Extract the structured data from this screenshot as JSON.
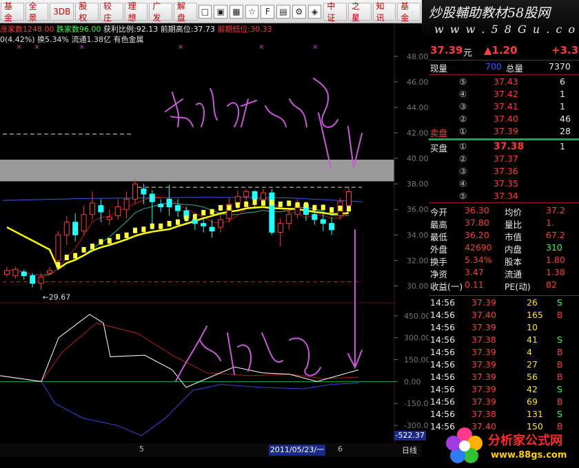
{
  "toolbar": {
    "buttons": [
      "基金",
      "全景",
      "3DB",
      "股权",
      "较庄",
      "理想",
      "广发",
      "解盘",
      "中证",
      "之星",
      "知讯",
      "基金"
    ]
  },
  "brand": {
    "title": "炒股輔助教材58股网",
    "url": "w w w . 5 8 G u . c o m"
  },
  "infobar": {
    "up_label": "涨家数",
    "up_value": "1248.00",
    "down_label": "跌家数",
    "down_value": "96.00",
    "profit_label": "获利比例:",
    "profit_value": "92.13",
    "high_label": "前期高位:",
    "high_value": "37.73",
    "low_label": "前期低位:",
    "low_value": "30.33"
  },
  "subbar": {
    "text": "0(4.42%) 换5.34% 流通1.38亿 有色金属"
  },
  "chart_data": {
    "type": "candlestick",
    "price_axis": {
      "ticks": [
        30,
        32,
        34,
        36,
        38,
        40,
        42,
        44,
        46,
        48
      ],
      "range": [
        29,
        49.5
      ]
    },
    "indicator_axis": {
      "ticks": [
        450,
        300,
        150,
        0,
        -150,
        -300
      ],
      "range": [
        -375,
        520
      ]
    },
    "candles": [
      {
        "o": 30.9,
        "c": 31.2,
        "h": 31.5,
        "l": 30.7
      },
      {
        "o": 30.8,
        "c": 31.3,
        "h": 31.5,
        "l": 30.6
      },
      {
        "o": 31.1,
        "c": 30.8,
        "h": 31.3,
        "l": 30.5
      },
      {
        "o": 30.8,
        "c": 30.2,
        "h": 31.0,
        "l": 29.9
      },
      {
        "o": 30.2,
        "c": 30.7,
        "h": 31.0,
        "l": 29.67
      },
      {
        "o": 31.0,
        "c": 31.2,
        "h": 31.5,
        "l": 30.9
      },
      {
        "o": 32.0,
        "c": 34.0,
        "h": 34.3,
        "l": 31.8
      },
      {
        "o": 34.0,
        "c": 35.0,
        "h": 35.5,
        "l": 33.2
      },
      {
        "o": 35.0,
        "c": 34.0,
        "h": 35.7,
        "l": 33.5
      },
      {
        "o": 34.3,
        "c": 35.6,
        "h": 36.3,
        "l": 34.0
      },
      {
        "o": 35.6,
        "c": 36.5,
        "h": 37.4,
        "l": 35.2
      },
      {
        "o": 36.3,
        "c": 35.8,
        "h": 36.8,
        "l": 35.0
      },
      {
        "o": 35.2,
        "c": 35.4,
        "h": 36.0,
        "l": 34.8
      },
      {
        "o": 35.5,
        "c": 36.2,
        "h": 36.8,
        "l": 35.2
      },
      {
        "o": 36.0,
        "c": 36.8,
        "h": 37.4,
        "l": 35.3
      },
      {
        "o": 36.8,
        "c": 38.0,
        "h": 38.4,
        "l": 36.4
      },
      {
        "o": 37.6,
        "c": 37.2,
        "h": 38.0,
        "l": 36.4
      },
      {
        "o": 37.2,
        "c": 36.6,
        "h": 37.5,
        "l": 34.4
      },
      {
        "o": 36.4,
        "c": 36.2,
        "h": 36.8,
        "l": 35.8
      },
      {
        "o": 36.8,
        "c": 36.2,
        "h": 37.9,
        "l": 35.5
      },
      {
        "o": 36.3,
        "c": 35.9,
        "h": 36.8,
        "l": 35.4
      },
      {
        "o": 35.9,
        "c": 35.3,
        "h": 36.2,
        "l": 35.0
      },
      {
        "o": 35.2,
        "c": 34.9,
        "h": 35.7,
        "l": 34.4
      },
      {
        "o": 34.9,
        "c": 34.7,
        "h": 35.3,
        "l": 34.2
      },
      {
        "o": 34.6,
        "c": 34.3,
        "h": 35.2,
        "l": 33.8
      },
      {
        "o": 34.6,
        "c": 35.2,
        "h": 35.6,
        "l": 34.2
      },
      {
        "o": 35.3,
        "c": 36.4,
        "h": 36.9,
        "l": 35.0
      },
      {
        "o": 36.4,
        "c": 37.0,
        "h": 37.5,
        "l": 36.0
      },
      {
        "o": 37.0,
        "c": 37.4,
        "h": 37.6,
        "l": 36.6
      },
      {
        "o": 37.4,
        "c": 36.8,
        "h": 37.5,
        "l": 36.2
      },
      {
        "o": 36.8,
        "c": 37.3,
        "h": 37.6,
        "l": 36.3
      },
      {
        "o": 37.3,
        "c": 34.2,
        "h": 37.6,
        "l": 34.0
      },
      {
        "o": 34.2,
        "c": 34.9,
        "h": 35.3,
        "l": 33.1
      },
      {
        "o": 34.9,
        "c": 35.6,
        "h": 36.0,
        "l": 34.4
      },
      {
        "o": 35.6,
        "c": 36.4,
        "h": 36.8,
        "l": 35.3
      },
      {
        "o": 36.4,
        "c": 35.6,
        "h": 36.6,
        "l": 35.1
      },
      {
        "o": 35.6,
        "c": 35.2,
        "h": 36.0,
        "l": 34.8
      },
      {
        "o": 35.2,
        "c": 34.9,
        "h": 35.8,
        "l": 34.3
      },
      {
        "o": 34.9,
        "c": 34.4,
        "h": 35.4,
        "l": 34.0
      },
      {
        "o": 35.5,
        "c": 36.6,
        "h": 36.9,
        "l": 35.2
      },
      {
        "o": 36.3,
        "c": 37.39,
        "h": 37.8,
        "l": 36.2
      }
    ],
    "annotations": {
      "low_marker": "←29.67",
      "indicator_value": "-522.37",
      "date_label": "2011/05/23/一",
      "tick_5": "5",
      "tick_6": "6",
      "period": "日线"
    }
  },
  "quote": {
    "price": "37.39",
    "price_unit": "元",
    "change": "▲1.20",
    "change_pct": "+3.3",
    "volume_label": "现量",
    "volume_value": "700",
    "total_label": "总量",
    "total_value": "7370",
    "asks": [
      {
        "n": "⑤",
        "p": "37.43",
        "v": "6"
      },
      {
        "n": "④",
        "p": "37.42",
        "v": "1"
      },
      {
        "n": "③",
        "p": "37.41",
        "v": "1"
      },
      {
        "n": "②",
        "p": "37.40",
        "v": "46"
      },
      {
        "n": "①",
        "p": "37.39",
        "v": "28"
      }
    ],
    "ask_label": "卖盘",
    "bid_label": "买盘",
    "bids": [
      {
        "n": "①",
        "p": "37.38",
        "v": "1"
      },
      {
        "n": "②",
        "p": "37.37",
        "v": ""
      },
      {
        "n": "③",
        "p": "37.36",
        "v": ""
      },
      {
        "n": "④",
        "p": "37.35",
        "v": ""
      },
      {
        "n": "⑤",
        "p": "37.34",
        "v": ""
      }
    ],
    "stats": [
      [
        "今开",
        "36.30",
        "均价",
        "37.2"
      ],
      [
        "最高",
        "37.80",
        "量比",
        "1."
      ],
      [
        "最低",
        "36.20",
        "市值",
        "67.2"
      ],
      [
        "外盘",
        "42690",
        "内盘",
        "310"
      ],
      [
        "换手",
        "5.34%",
        "股本",
        "1.80"
      ],
      [
        "净资",
        "3.47",
        "流通",
        "1.38"
      ],
      [
        "收益(一)",
        "0.11",
        "PE(动)",
        "82"
      ]
    ],
    "ticks": [
      [
        "14:56",
        "37.39",
        "26",
        "S"
      ],
      [
        "14:56",
        "37.40",
        "165",
        "B"
      ],
      [
        "14:56",
        "37.39",
        "10",
        ""
      ],
      [
        "14:56",
        "37.38",
        "41",
        "S"
      ],
      [
        "14:56",
        "37.39",
        "4",
        "B"
      ],
      [
        "14:56",
        "37.39",
        "27",
        "B"
      ],
      [
        "14:56",
        "37.39",
        "56",
        "B"
      ],
      [
        "14:56",
        "37.39",
        "42",
        "S"
      ],
      [
        "14:56",
        "37.39",
        "69",
        "B"
      ],
      [
        "14:56",
        "37.38",
        "131",
        "S"
      ],
      [
        "14:56",
        "37.40",
        "150",
        "B"
      ]
    ]
  },
  "watermark": {
    "text": "分析家公式网",
    "url": "www.88gs.com"
  },
  "colors": {
    "up": "#ff3b3b",
    "down": "#22ffff",
    "ma5": "#ffff40",
    "ma_slow": "#ffff00",
    "handwriting": "#c85ad8"
  }
}
